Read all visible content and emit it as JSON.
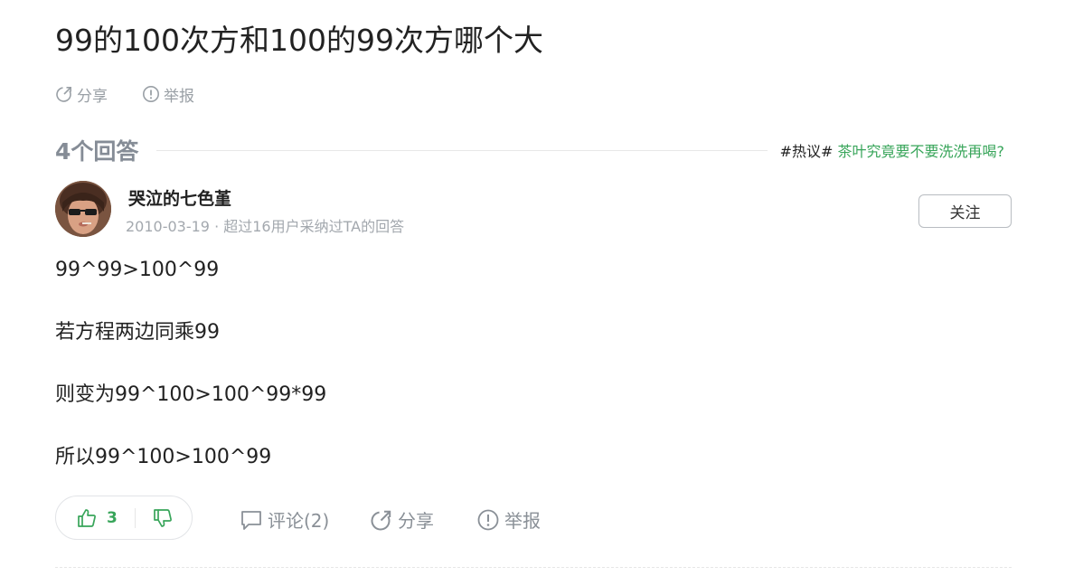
{
  "question": {
    "title": "99的100次方和100的99次方哪个大",
    "share_label": "分享",
    "report_label": "举报"
  },
  "answers_header": {
    "count_label": "4个回答",
    "hot_tag": "#热议#",
    "hot_link": "茶叶究竟要不要洗洗再喝?"
  },
  "answer": {
    "author": {
      "name": "哭泣的七色堇",
      "meta": "2010-03-19 · 超过16用户采纳过TA的回答",
      "follow_label": "关注"
    },
    "lines": [
      "99^99>100^99",
      "若方程两边同乘99",
      "则变为99^100>100^99*99",
      "所以99^100>100^99"
    ],
    "actions": {
      "upvote_count": "3",
      "comment_label": "评论(2)",
      "share_label": "分享",
      "report_label": "举报"
    }
  },
  "colors": {
    "accent_green": "#38a55a",
    "muted_gray": "#9aa0a6"
  }
}
